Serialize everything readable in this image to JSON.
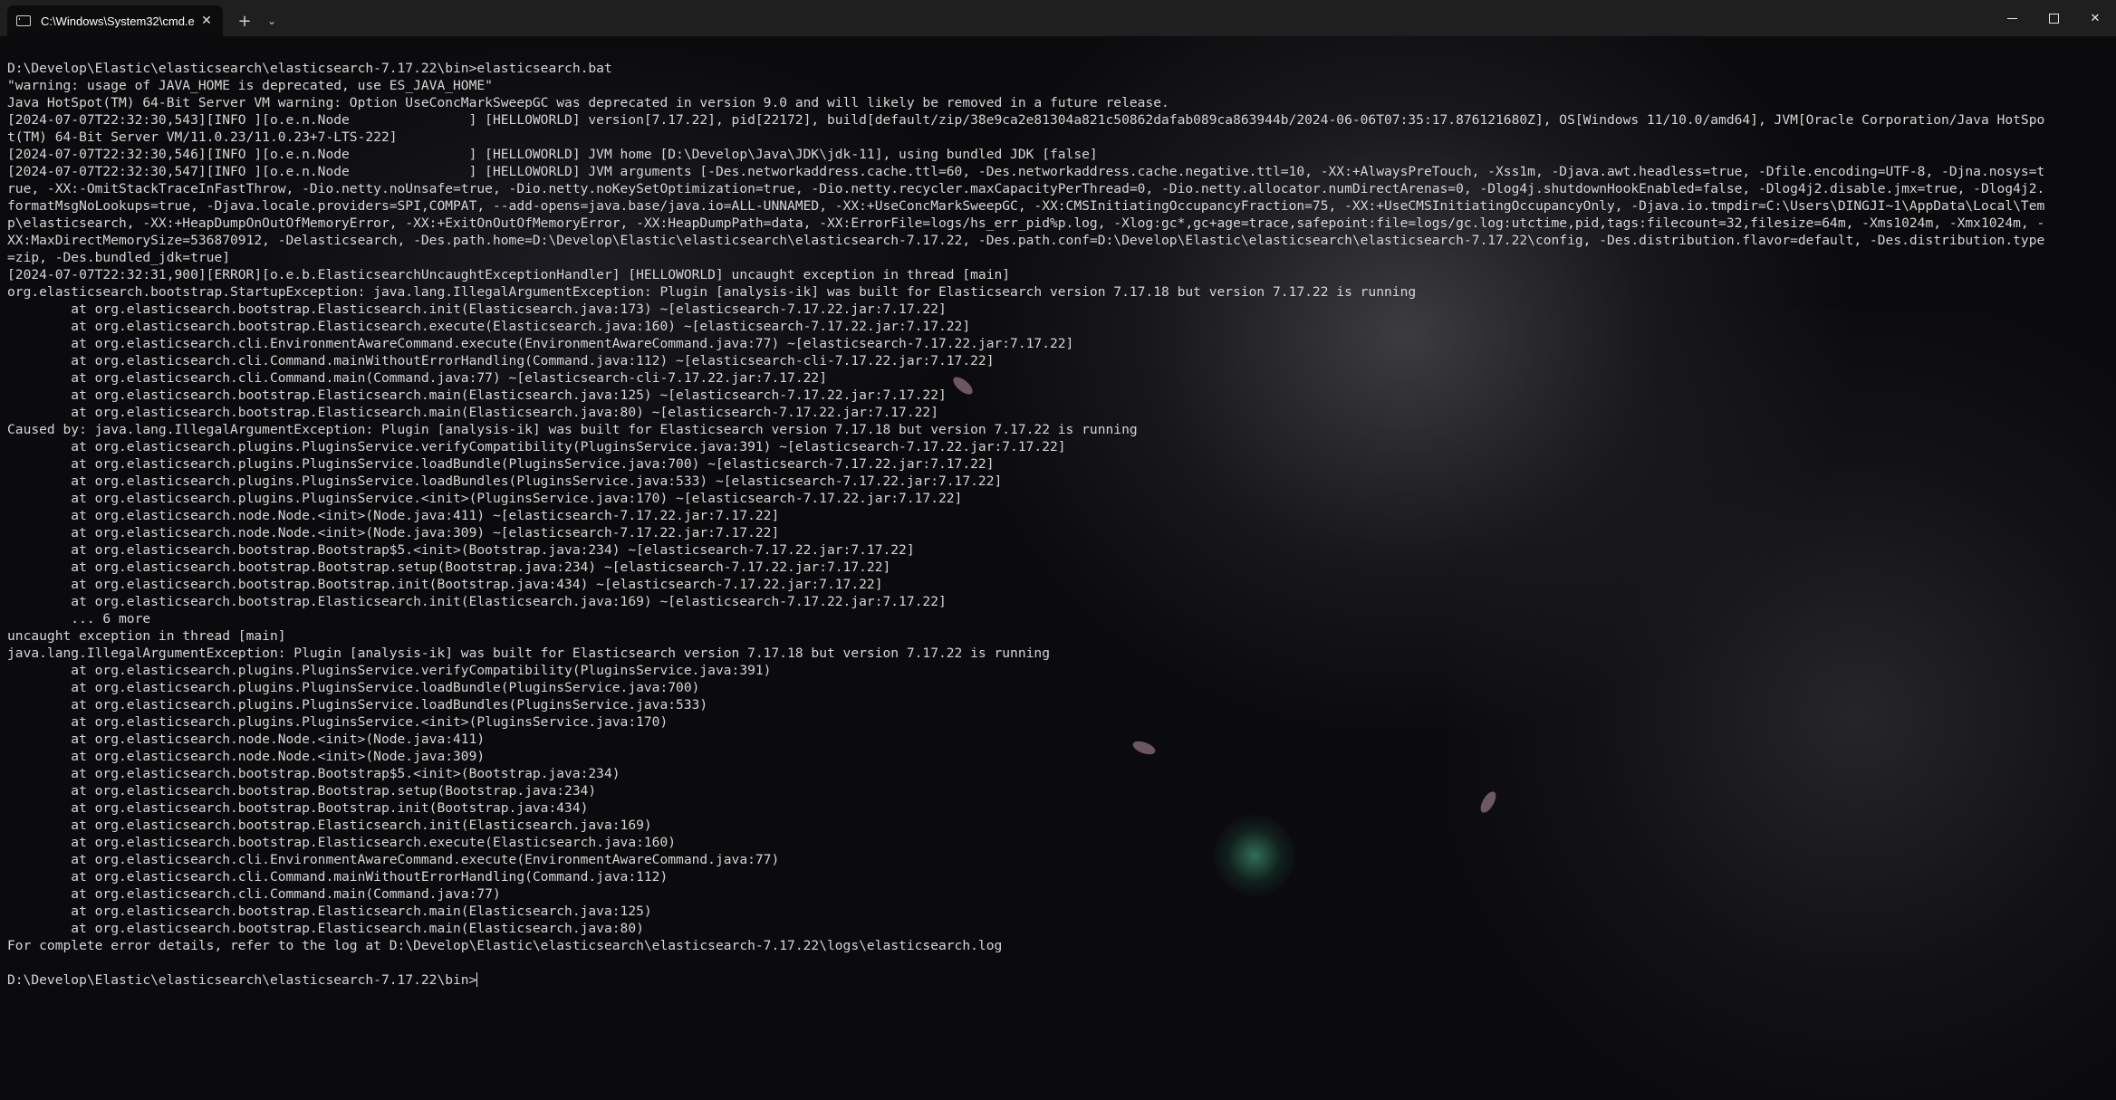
{
  "titlebar": {
    "tab_title": "C:\\Windows\\System32\\cmd.e",
    "close_glyph": "✕",
    "new_tab_glyph": "+",
    "dropdown_glyph": "⌄",
    "close_window_glyph": "✕"
  },
  "console": {
    "lines": [
      "D:\\Develop\\Elastic\\elasticsearch\\elasticsearch-7.17.22\\bin>elasticsearch.bat",
      "\"warning: usage of JAVA_HOME is deprecated, use ES_JAVA_HOME\"",
      "Java HotSpot(TM) 64-Bit Server VM warning: Option UseConcMarkSweepGC was deprecated in version 9.0 and will likely be removed in a future release.",
      "[2024-07-07T22:32:30,543][INFO ][o.e.n.Node               ] [HELLOWORLD] version[7.17.22], pid[22172], build[default/zip/38e9ca2e81304a821c50862dafab089ca863944b/2024-06-06T07:35:17.876121680Z], OS[Windows 11/10.0/amd64], JVM[Oracle Corporation/Java HotSpo",
      "t(TM) 64-Bit Server VM/11.0.23/11.0.23+7-LTS-222]",
      "[2024-07-07T22:32:30,546][INFO ][o.e.n.Node               ] [HELLOWORLD] JVM home [D:\\Develop\\Java\\JDK\\jdk-11], using bundled JDK [false]",
      "[2024-07-07T22:32:30,547][INFO ][o.e.n.Node               ] [HELLOWORLD] JVM arguments [-Des.networkaddress.cache.ttl=60, -Des.networkaddress.cache.negative.ttl=10, -XX:+AlwaysPreTouch, -Xss1m, -Djava.awt.headless=true, -Dfile.encoding=UTF-8, -Djna.nosys=t",
      "rue, -XX:-OmitStackTraceInFastThrow, -Dio.netty.noUnsafe=true, -Dio.netty.noKeySetOptimization=true, -Dio.netty.recycler.maxCapacityPerThread=0, -Dio.netty.allocator.numDirectArenas=0, -Dlog4j.shutdownHookEnabled=false, -Dlog4j2.disable.jmx=true, -Dlog4j2.",
      "formatMsgNoLookups=true, -Djava.locale.providers=SPI,COMPAT, --add-opens=java.base/java.io=ALL-UNNAMED, -XX:+UseConcMarkSweepGC, -XX:CMSInitiatingOccupancyFraction=75, -XX:+UseCMSInitiatingOccupancyOnly, -Djava.io.tmpdir=C:\\Users\\DINGJI~1\\AppData\\Local\\Tem",
      "p\\elasticsearch, -XX:+HeapDumpOnOutOfMemoryError, -XX:+ExitOnOutOfMemoryError, -XX:HeapDumpPath=data, -XX:ErrorFile=logs/hs_err_pid%p.log, -Xlog:gc*,gc+age=trace,safepoint:file=logs/gc.log:utctime,pid,tags:filecount=32,filesize=64m, -Xms1024m, -Xmx1024m, -",
      "XX:MaxDirectMemorySize=536870912, -Delasticsearch, -Des.path.home=D:\\Develop\\Elastic\\elasticsearch\\elasticsearch-7.17.22, -Des.path.conf=D:\\Develop\\Elastic\\elasticsearch\\elasticsearch-7.17.22\\config, -Des.distribution.flavor=default, -Des.distribution.type",
      "=zip, -Des.bundled_jdk=true]",
      "[2024-07-07T22:32:31,900][ERROR][o.e.b.ElasticsearchUncaughtExceptionHandler] [HELLOWORLD] uncaught exception in thread [main]",
      "org.elasticsearch.bootstrap.StartupException: java.lang.IllegalArgumentException: Plugin [analysis-ik] was built for Elasticsearch version 7.17.18 but version 7.17.22 is running",
      "        at org.elasticsearch.bootstrap.Elasticsearch.init(Elasticsearch.java:173) ~[elasticsearch-7.17.22.jar:7.17.22]",
      "        at org.elasticsearch.bootstrap.Elasticsearch.execute(Elasticsearch.java:160) ~[elasticsearch-7.17.22.jar:7.17.22]",
      "        at org.elasticsearch.cli.EnvironmentAwareCommand.execute(EnvironmentAwareCommand.java:77) ~[elasticsearch-7.17.22.jar:7.17.22]",
      "        at org.elasticsearch.cli.Command.mainWithoutErrorHandling(Command.java:112) ~[elasticsearch-cli-7.17.22.jar:7.17.22]",
      "        at org.elasticsearch.cli.Command.main(Command.java:77) ~[elasticsearch-cli-7.17.22.jar:7.17.22]",
      "        at org.elasticsearch.bootstrap.Elasticsearch.main(Elasticsearch.java:125) ~[elasticsearch-7.17.22.jar:7.17.22]",
      "        at org.elasticsearch.bootstrap.Elasticsearch.main(Elasticsearch.java:80) ~[elasticsearch-7.17.22.jar:7.17.22]",
      "Caused by: java.lang.IllegalArgumentException: Plugin [analysis-ik] was built for Elasticsearch version 7.17.18 but version 7.17.22 is running",
      "        at org.elasticsearch.plugins.PluginsService.verifyCompatibility(PluginsService.java:391) ~[elasticsearch-7.17.22.jar:7.17.22]",
      "        at org.elasticsearch.plugins.PluginsService.loadBundle(PluginsService.java:700) ~[elasticsearch-7.17.22.jar:7.17.22]",
      "        at org.elasticsearch.plugins.PluginsService.loadBundles(PluginsService.java:533) ~[elasticsearch-7.17.22.jar:7.17.22]",
      "        at org.elasticsearch.plugins.PluginsService.<init>(PluginsService.java:170) ~[elasticsearch-7.17.22.jar:7.17.22]",
      "        at org.elasticsearch.node.Node.<init>(Node.java:411) ~[elasticsearch-7.17.22.jar:7.17.22]",
      "        at org.elasticsearch.node.Node.<init>(Node.java:309) ~[elasticsearch-7.17.22.jar:7.17.22]",
      "        at org.elasticsearch.bootstrap.Bootstrap$5.<init>(Bootstrap.java:234) ~[elasticsearch-7.17.22.jar:7.17.22]",
      "        at org.elasticsearch.bootstrap.Bootstrap.setup(Bootstrap.java:234) ~[elasticsearch-7.17.22.jar:7.17.22]",
      "        at org.elasticsearch.bootstrap.Bootstrap.init(Bootstrap.java:434) ~[elasticsearch-7.17.22.jar:7.17.22]",
      "        at org.elasticsearch.bootstrap.Elasticsearch.init(Elasticsearch.java:169) ~[elasticsearch-7.17.22.jar:7.17.22]",
      "        ... 6 more",
      "uncaught exception in thread [main]",
      "java.lang.IllegalArgumentException: Plugin [analysis-ik] was built for Elasticsearch version 7.17.18 but version 7.17.22 is running",
      "        at org.elasticsearch.plugins.PluginsService.verifyCompatibility(PluginsService.java:391)",
      "        at org.elasticsearch.plugins.PluginsService.loadBundle(PluginsService.java:700)",
      "        at org.elasticsearch.plugins.PluginsService.loadBundles(PluginsService.java:533)",
      "        at org.elasticsearch.plugins.PluginsService.<init>(PluginsService.java:170)",
      "        at org.elasticsearch.node.Node.<init>(Node.java:411)",
      "        at org.elasticsearch.node.Node.<init>(Node.java:309)",
      "        at org.elasticsearch.bootstrap.Bootstrap$5.<init>(Bootstrap.java:234)",
      "        at org.elasticsearch.bootstrap.Bootstrap.setup(Bootstrap.java:234)",
      "        at org.elasticsearch.bootstrap.Bootstrap.init(Bootstrap.java:434)",
      "        at org.elasticsearch.bootstrap.Elasticsearch.init(Elasticsearch.java:169)",
      "        at org.elasticsearch.bootstrap.Elasticsearch.execute(Elasticsearch.java:160)",
      "        at org.elasticsearch.cli.EnvironmentAwareCommand.execute(EnvironmentAwareCommand.java:77)",
      "        at org.elasticsearch.cli.Command.mainWithoutErrorHandling(Command.java:112)",
      "        at org.elasticsearch.cli.Command.main(Command.java:77)",
      "        at org.elasticsearch.bootstrap.Elasticsearch.main(Elasticsearch.java:125)",
      "        at org.elasticsearch.bootstrap.Elasticsearch.main(Elasticsearch.java:80)",
      "For complete error details, refer to the log at D:\\Develop\\Elastic\\elasticsearch\\elasticsearch-7.17.22\\logs\\elasticsearch.log",
      "",
      "D:\\Develop\\Elastic\\elasticsearch\\elasticsearch-7.17.22\\bin>"
    ]
  },
  "colors": {
    "titlebar_bg": "#1f1f1f",
    "tab_bg": "#0c0c0c",
    "console_text": "#d6d6d6"
  }
}
